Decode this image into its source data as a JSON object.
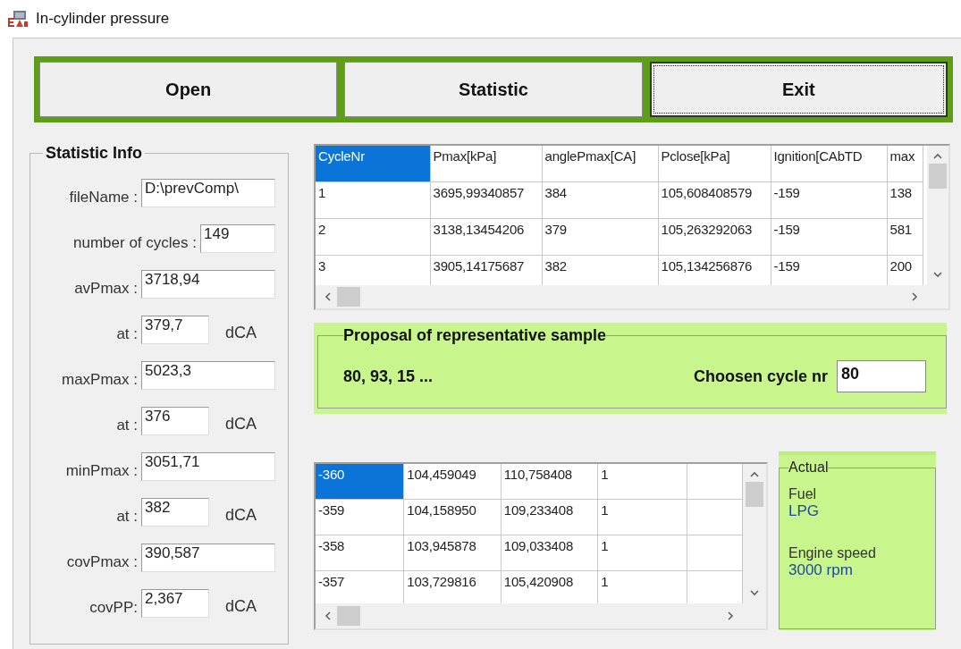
{
  "window": {
    "title": "In-cylinder pressure"
  },
  "buttons": [
    {
      "label": "Open",
      "focused": false
    },
    {
      "label": "Statistic",
      "focused": false
    },
    {
      "label": "Exit",
      "focused": true
    }
  ],
  "statistic_info": {
    "title": "Statistic Info",
    "fields": [
      {
        "kind": "wide",
        "label": "fileName :",
        "value": "D:\\prevComp\\"
      },
      {
        "kind": "count",
        "label": "number of cycles :",
        "value": "149"
      },
      {
        "kind": "wide",
        "label": "avPmax :",
        "value": "3718,94"
      },
      {
        "kind": "angle",
        "label": "at :",
        "value": "379,7",
        "unit": "dCA"
      },
      {
        "kind": "wide",
        "label": "maxPmax :",
        "value": "5023,3"
      },
      {
        "kind": "angle",
        "label": "at :",
        "value": "376",
        "unit": "dCA"
      },
      {
        "kind": "wide",
        "label": "minPmax :",
        "value": "3051,71"
      },
      {
        "kind": "angle",
        "label": "at :",
        "value": "382",
        "unit": "dCA"
      },
      {
        "kind": "wide",
        "label": "covPmax :",
        "value": "390,587"
      },
      {
        "kind": "angle",
        "label": "covPP:",
        "value": "2,367",
        "unit": "dCA"
      }
    ]
  },
  "cycles_table": {
    "columns": [
      {
        "label": "CycleNr",
        "selected": true
      },
      {
        "label": "Pmax[kPa]",
        "selected": false
      },
      {
        "label": "anglePmax[CA]",
        "selected": false
      },
      {
        "label": "Pclose[kPa]",
        "selected": false
      },
      {
        "label": "Ignition[CAbTD",
        "selected": false
      },
      {
        "label": "max",
        "selected": false
      }
    ],
    "rows": [
      [
        "1",
        "3695,99340857",
        "384",
        "105,608408579",
        "-159",
        "138"
      ],
      [
        "2",
        "3138,13454206",
        "379",
        "105,263292063",
        "-159",
        "581"
      ],
      [
        "3",
        "3905,14175687",
        "382",
        "105,134256876",
        "-159",
        "200"
      ]
    ]
  },
  "proposal": {
    "title": "Proposal of representative sample",
    "samples": "80, 93, 15 ...",
    "chosen_label": "Choosen cycle nr",
    "chosen_value": "80"
  },
  "pressure_table": {
    "rows": [
      {
        "selected": true,
        "cells": [
          "-360",
          "104,459049",
          "110,758408",
          "1",
          ""
        ]
      },
      {
        "selected": false,
        "cells": [
          "-359",
          "104,158950",
          "109,233408",
          "1",
          ""
        ]
      },
      {
        "selected": false,
        "cells": [
          "-358",
          "103,945878",
          "109,033408",
          "1",
          ""
        ]
      },
      {
        "selected": false,
        "cells": [
          "-357",
          "103,729816",
          "105,420908",
          "1",
          ""
        ]
      }
    ]
  },
  "actual": {
    "title": "Actual",
    "items": [
      {
        "label": "Fuel",
        "value": "LPG"
      },
      {
        "label": "Engine speed",
        "value": "3000 rpm"
      }
    ]
  }
}
